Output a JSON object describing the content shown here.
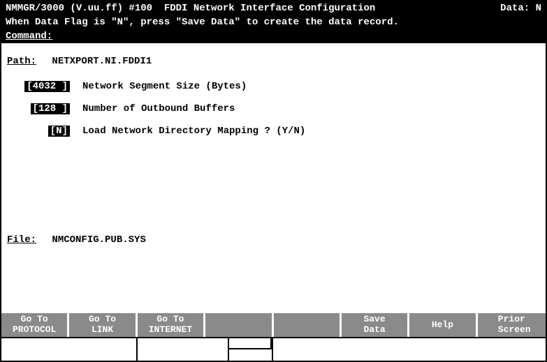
{
  "header": {
    "title": "NMMGR/3000 (V.uu.ff) #100  FDDI Network Interface Configuration",
    "data_label": "Data:",
    "data_flag": "N"
  },
  "subheader": "When Data Flag is \"N\", press \"Save Data\" to create the data record.",
  "command": {
    "label": "Command:",
    "value": ""
  },
  "path": {
    "label": "Path:",
    "value": "NETXPORT.NI.FDDI1"
  },
  "fields": [
    {
      "value": "[4032 ]",
      "label": "Network Segment Size (Bytes)"
    },
    {
      "value": "[128 ]",
      "label": "Number of Outbound Buffers"
    },
    {
      "value": "[N]",
      "label": "Load Network Directory Mapping ? (Y/N)"
    }
  ],
  "file": {
    "label": "File:",
    "value": "NMCONFIG.PUB.SYS"
  },
  "fkeys": [
    {
      "line1": " Go To ",
      "line2": "PROTOCOL"
    },
    {
      "line1": " Go To ",
      "line2": "  LINK  "
    },
    {
      "line1": " Go To ",
      "line2": "INTERNET"
    },
    {
      "line1": "",
      "line2": ""
    },
    {
      "line1": "",
      "line2": ""
    },
    {
      "line1": "  Save  ",
      "line2": "  Data  "
    },
    {
      "line1": "  Help  ",
      "line2": ""
    },
    {
      "line1": " Prior ",
      "line2": " Screen"
    }
  ]
}
